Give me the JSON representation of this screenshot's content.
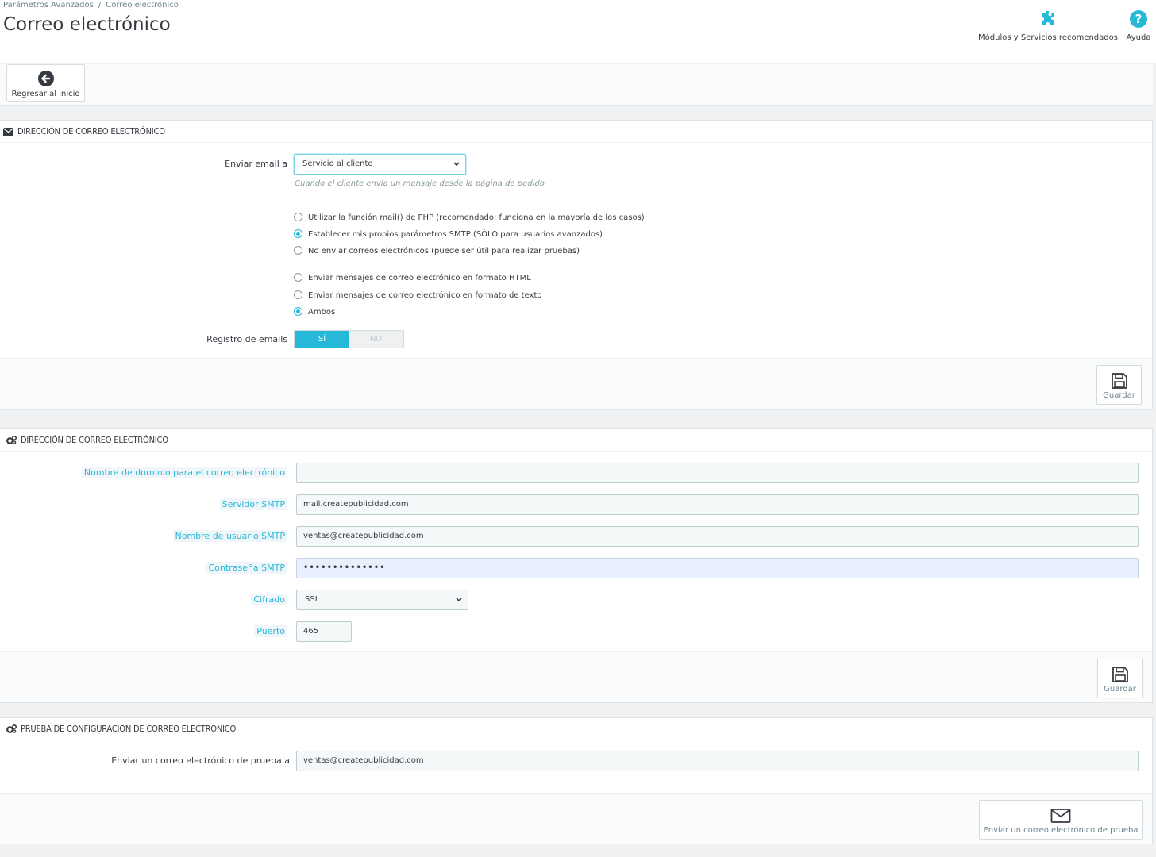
{
  "header": {
    "breadcrumb": [
      "Parámetros Avanzados",
      "Correo electrónico"
    ],
    "breadcrumb_sep": "/",
    "title": "Correo electrónico",
    "modules_label": "Módulos y Servicios recomendados",
    "help_label": "Ayuda"
  },
  "toolbar": {
    "back_label": "Regresar al inicio"
  },
  "panel1": {
    "heading": "DIRECCIÓN DE CORREO ELECTRÓNICO",
    "send_to_label": "Enviar email a",
    "send_to_value": "Servicio al cliente",
    "send_to_hint": "Cuando el cliente envía un mensaje desde la página de pedido",
    "mail_method_options": [
      {
        "label": "Utilizar la función mail() de PHP (recomendado; funciona en la mayoría de los casos)",
        "checked": false
      },
      {
        "label": "Establecer mis propios parámetros SMTP (SÓLO para usuarios avanzados)",
        "checked": true
      },
      {
        "label": "No enviar correos electrónicos (puede ser útil para realizar pruebas)",
        "checked": false
      }
    ],
    "format_options": [
      {
        "label": "Enviar mensajes de correo electrónico en formato HTML",
        "checked": false
      },
      {
        "label": "Enviar mensajes de correo electrónico en formato de texto",
        "checked": false
      },
      {
        "label": "Ambos",
        "checked": true
      }
    ],
    "log_label": "Registro de emails",
    "log_yes": "SÍ",
    "log_no": "NO",
    "save_label": "Guardar"
  },
  "panel2": {
    "heading": "DIRECCIÓN DE CORREO ELECTRÓNICO",
    "domain_label": "Nombre de dominio para el correo electrónico",
    "domain_value": "",
    "smtp_server_label": "Servidor SMTP",
    "smtp_server_value": "mail.createpublicidad.com",
    "smtp_user_label": "Nombre de usuario SMTP",
    "smtp_user_value": "ventas@createpublicidad.com",
    "smtp_password_label": "Contraseña SMTP",
    "smtp_password_value": "••••••••••••••",
    "encryption_label": "Cifrado",
    "encryption_value": "SSL",
    "port_label": "Puerto",
    "port_value": "465",
    "save_label": "Guardar"
  },
  "panel3": {
    "heading": "PRUEBA DE CONFIGURACIÓN DE CORREO ELECTRÓNICO",
    "test_to_label": "Enviar un correo electrónico de prueba a",
    "test_to_value": "ventas@createpublicidad.com",
    "send_test_label": "Enviar un correo electrónico de prueba"
  },
  "colors": {
    "accent": "#25b9d7",
    "text": "#363a41",
    "muted": "#6c868e"
  },
  "icons": [
    "puzzle-icon",
    "help-icon",
    "back-arrow-icon",
    "envelope-icon",
    "cogs-icon",
    "save-icon",
    "chevron-down-icon",
    "mail-icon"
  ]
}
